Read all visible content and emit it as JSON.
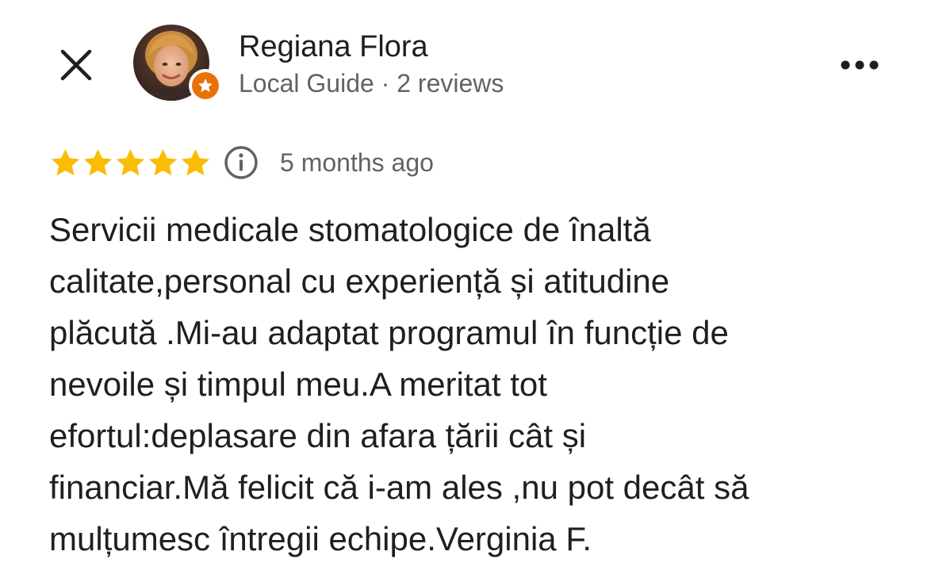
{
  "reviewer": {
    "name": "Regiana Flora",
    "meta": "Local Guide · 2 reviews"
  },
  "review": {
    "rating": 5,
    "rating_max": 5,
    "date": "5 months ago",
    "lines": [
      "Servicii medicale stomatologice de înaltă",
      "calitate,personal cu experiență și atitudine",
      "plăcută .Mi-au adaptat programul în funcție de",
      "nevoile și timpul meu.A meritat tot",
      "efortul:deplasare din afara țării cât și",
      "financiar.Mă felicit că i-am ales ,nu pot decât să",
      "mulțumesc întregii echipe.Verginia F."
    ]
  },
  "colors": {
    "star": "#fbbc04",
    "badge": "#e8710a",
    "text_primary": "#1f1f1f",
    "text_secondary": "#5f6368"
  },
  "icons": {
    "close": "close-icon",
    "more": "more-horizontal-icon",
    "info": "info-icon",
    "badge": "local-guide-star-icon",
    "star": "star-icon"
  }
}
